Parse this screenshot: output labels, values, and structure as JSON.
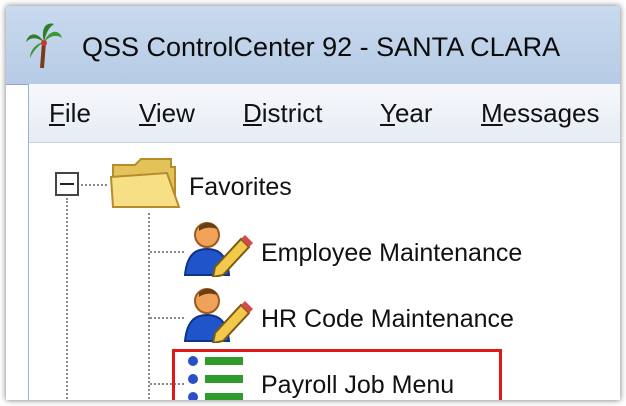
{
  "window": {
    "title": "QSS ControlCenter 92 - SANTA CLARA"
  },
  "menu": [
    {
      "accel": "F",
      "rest": "ile"
    },
    {
      "accel": "V",
      "rest": "iew"
    },
    {
      "accel": "D",
      "rest": "istrict"
    },
    {
      "accel": "Y",
      "rest": "ear"
    },
    {
      "accel": "M",
      "rest": "essages"
    }
  ],
  "tree": {
    "root": {
      "label": "Favorites",
      "expander": "−",
      "icon": "folder-icon"
    },
    "items": [
      {
        "label": "Employee Maintenance",
        "icon": "user-edit-icon"
      },
      {
        "label": "HR Code Maintenance",
        "icon": "user-edit-icon"
      },
      {
        "label": "Payroll Job Menu",
        "icon": "menu-list-icon"
      }
    ]
  },
  "colors": {
    "titlebar": "#c1d4ec",
    "highlight": "#e01818",
    "folder": "#f2d675",
    "list_bullet": "#2a4fc6",
    "list_bar": "#2f9b2a"
  }
}
